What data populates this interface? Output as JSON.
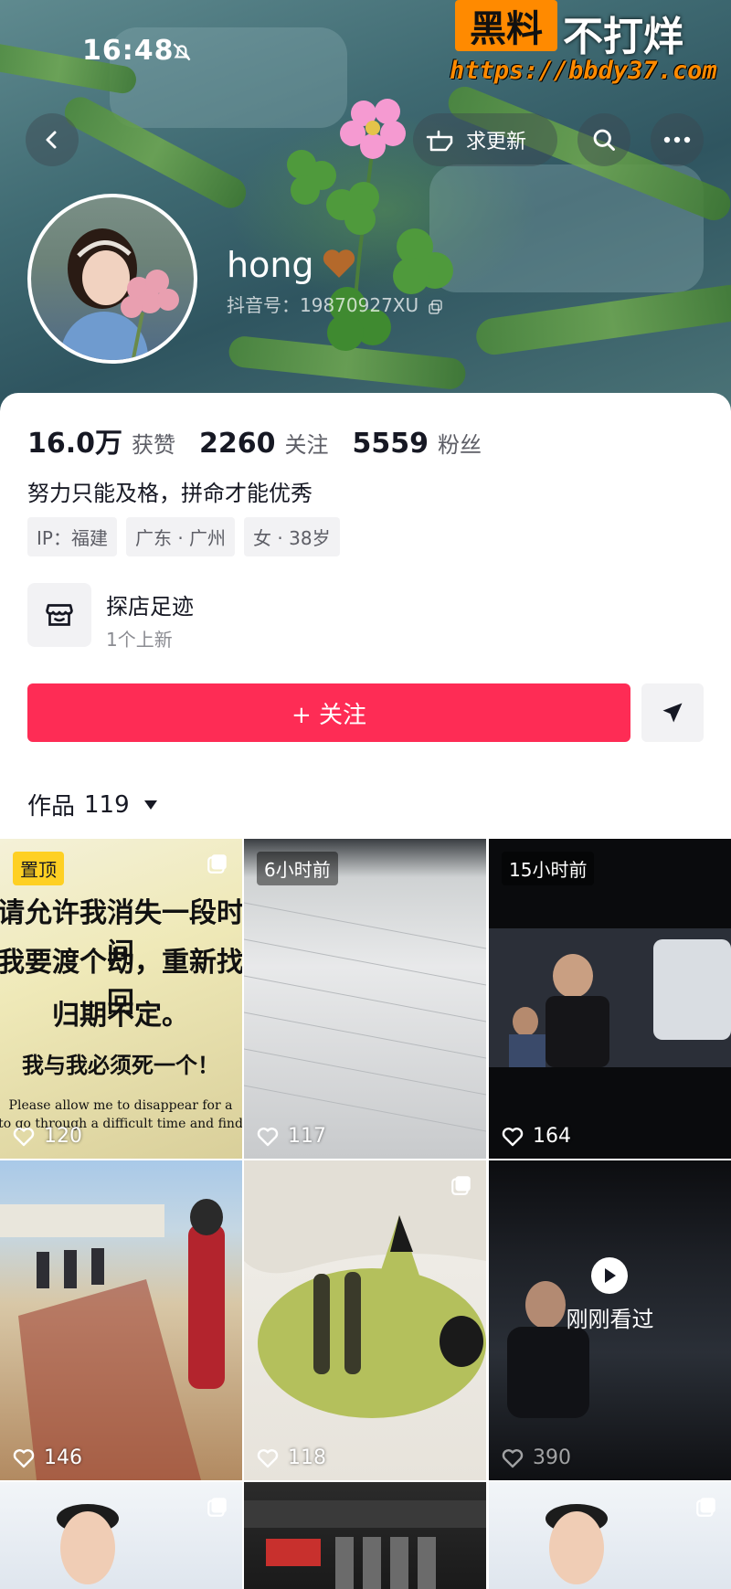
{
  "status_bar": {
    "time": "16:48"
  },
  "watermark": {
    "brand": "黑料",
    "slogan": "不打烊",
    "url": "https://bbdy37.com"
  },
  "header": {
    "request_update_label": "求更新"
  },
  "profile": {
    "nickname": "hong",
    "douyin_id": "抖音号：19870927XU",
    "stats": [
      {
        "value": "16.0万",
        "label": "获赞"
      },
      {
        "value": "2260",
        "label": "关注"
      },
      {
        "value": "5559",
        "label": "粉丝"
      }
    ],
    "bio": "努力只能及格，拼命才能优秀",
    "tags": [
      "IP：福建",
      "广东 · 广州",
      "女 · 38岁"
    ]
  },
  "shop": {
    "title": "探店足迹",
    "subtitle": "1个上新"
  },
  "actions": {
    "follow_label": "+ 关注"
  },
  "works": {
    "label": "作品",
    "count": "119"
  },
  "grid": [
    {
      "badge": "置顶",
      "likes": "120",
      "lines": [
        "请允许我消失一段时间",
        "我要渡个劫，重新找回",
        "归期不定。",
        "我与我必须死一个！",
        "Please allow me to disappear for a",
        "to go through a difficult time and find"
      ]
    },
    {
      "badge": "6小时前",
      "likes": "117"
    },
    {
      "badge": "15小时前",
      "likes": "164"
    },
    {
      "likes": "146"
    },
    {
      "likes": "118"
    },
    {
      "likes": "390",
      "overlay": "刚刚看过"
    },
    {},
    {},
    {}
  ],
  "colors": {
    "accent": "#fe2c55",
    "pin_badge": "#fed023",
    "watermark": "#ff8a00"
  }
}
